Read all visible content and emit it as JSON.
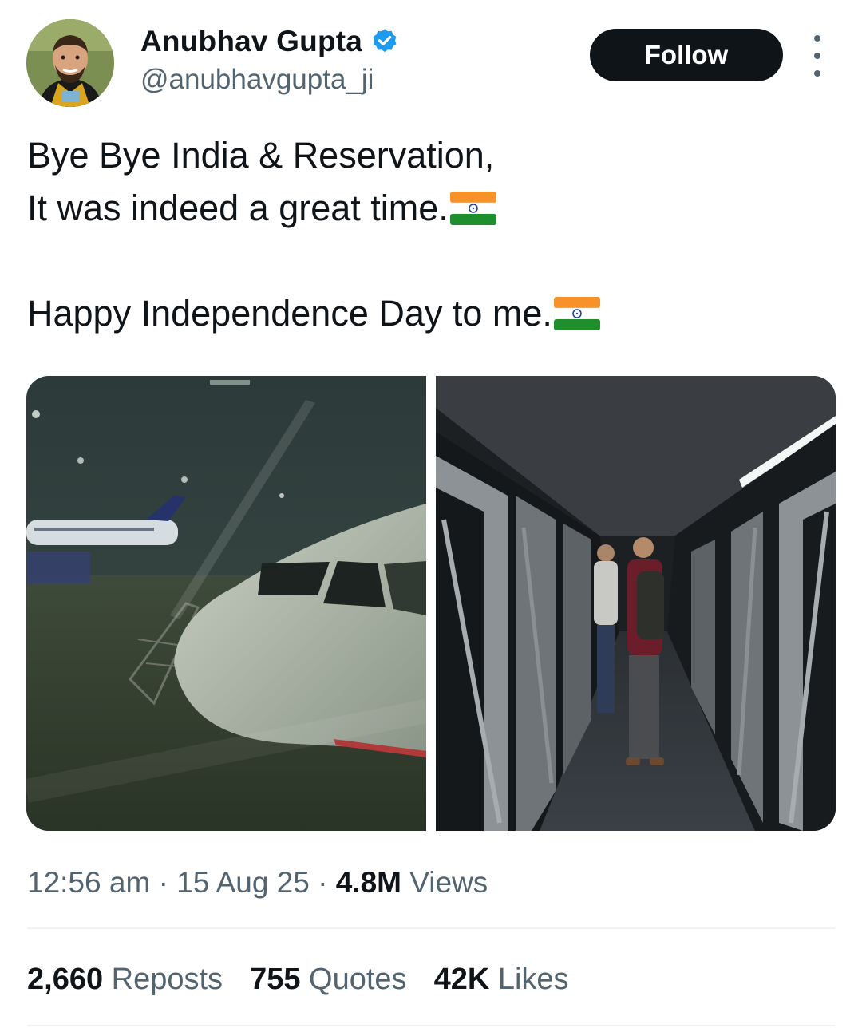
{
  "author": {
    "name": "Anubhav Gupta",
    "handle": "@anubhavgupta_ji",
    "verified_color": "#1d9bf0"
  },
  "actions": {
    "follow_label": "Follow",
    "more_icon": "more-vertical-icon"
  },
  "tweet": {
    "line1": "Bye Bye India & Reservation,",
    "line2": "It was indeed a great time.",
    "line3": "Happy Independence Day to me.",
    "flag_emoji": "india-flag"
  },
  "media": {
    "photo1": "airplane-through-window",
    "photo2": "jet-bridge-passengers"
  },
  "meta": {
    "time": "12:56 am",
    "date": "15 Aug 25",
    "views_count": "4.8M",
    "views_label": "Views",
    "separator": "·"
  },
  "stats": {
    "reposts_count": "2,660",
    "reposts_label": "Reposts",
    "quotes_count": "755",
    "quotes_label": "Quotes",
    "likes_count": "42K",
    "likes_label": "Likes"
  },
  "colors": {
    "text_primary": "#0f1419",
    "text_secondary": "#536471",
    "button_bg": "#0f1419",
    "divider": "#eff3f4"
  }
}
